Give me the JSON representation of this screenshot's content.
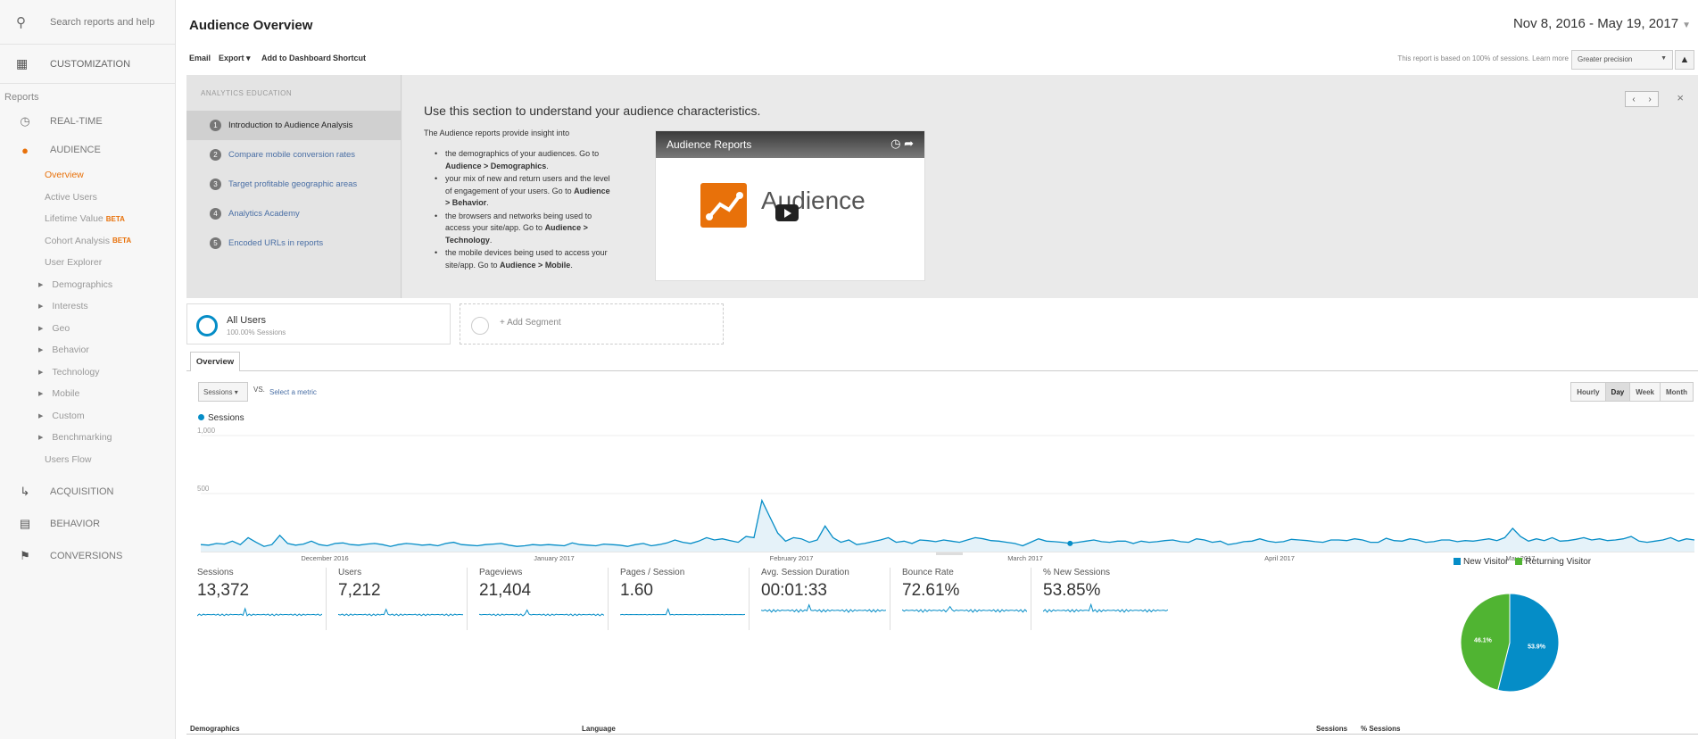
{
  "sidebar": {
    "search_label": "Search reports and help",
    "customization_label": "CUSTOMIZATION",
    "reports_label": "Reports",
    "realtime_label": "REAL-TIME",
    "audience_label": "AUDIENCE",
    "audience_items": [
      {
        "label": "Overview",
        "active": true
      },
      {
        "label": "Active Users"
      },
      {
        "label": "Lifetime Value",
        "badge": "BETA"
      },
      {
        "label": "Cohort Analysis",
        "badge": "BETA"
      },
      {
        "label": "User Explorer"
      },
      {
        "label": "Demographics",
        "expandable": true
      },
      {
        "label": "Interests",
        "expandable": true
      },
      {
        "label": "Geo",
        "expandable": true
      },
      {
        "label": "Behavior",
        "expandable": true
      },
      {
        "label": "Technology",
        "expandable": true
      },
      {
        "label": "Mobile",
        "expandable": true
      },
      {
        "label": "Custom",
        "expandable": true
      },
      {
        "label": "Benchmarking",
        "expandable": true
      },
      {
        "label": "Users Flow"
      }
    ],
    "acquisition_label": "ACQUISITION",
    "behavior_label": "BEHAVIOR",
    "conversions_label": "CONVERSIONS"
  },
  "header": {
    "title": "Audience Overview",
    "date_range": "Nov 8, 2016 - May 19, 2017"
  },
  "toolbar": {
    "email": "Email",
    "export": "Export ▾",
    "add_to_dashboard": "Add to Dashboard",
    "shortcut": "Shortcut",
    "note": "This report is based on 100% of sessions.",
    "learn_more": "Learn more",
    "precision": "Greater precision"
  },
  "education": {
    "heading": "ANALYTICS EDUCATION",
    "items": [
      {
        "num": "1",
        "label": "Introduction to Audience Analysis",
        "active": true
      },
      {
        "num": "2",
        "label": "Compare mobile conversion rates"
      },
      {
        "num": "3",
        "label": "Target profitable geographic areas"
      },
      {
        "num": "4",
        "label": "Analytics Academy"
      },
      {
        "num": "5",
        "label": "Encoded URLs in reports"
      }
    ],
    "title": "Use this section to understand your audience characteristics.",
    "intro": "The Audience reports provide insight into",
    "bullets": [
      {
        "text": "the demographics of your audiences. Go to ",
        "bold": "Audience > Demographics",
        "end": "."
      },
      {
        "text": "your mix of new and return users and the level of engagement of your users. Go to ",
        "bold": "Audience > Behavior",
        "end": "."
      },
      {
        "text": "the browsers and networks being used to access your site/app. Go to ",
        "bold": "Audience > Technology",
        "end": "."
      },
      {
        "text": "the mobile devices being used to access your site/app. Go to ",
        "bold": "Audience > Mobile",
        "end": "."
      }
    ],
    "video_title": "Audience Reports",
    "video_word": "Audience"
  },
  "segments": {
    "all_users": "All Users",
    "all_users_sub": "100.00% Sessions",
    "add_segment": "+ Add Segment"
  },
  "tabs": {
    "overview": "Overview"
  },
  "controls": {
    "metric": "Sessions",
    "vs": "VS.",
    "select_metric": "Select a metric",
    "granularity": [
      {
        "label": "Hourly"
      },
      {
        "label": "Day",
        "active": true
      },
      {
        "label": "Week"
      },
      {
        "label": "Month"
      }
    ]
  },
  "chart_data": {
    "type": "area",
    "series": [
      {
        "name": "Sessions",
        "color": "#058dc7"
      }
    ],
    "y_tick_labels": [
      "1,000",
      "500"
    ],
    "x_tick_labels": [
      "December 2016",
      "January 2017",
      "February 2017",
      "March 2017",
      "April 2017",
      "May 2017"
    ],
    "values": [
      60,
      55,
      70,
      65,
      90,
      60,
      120,
      80,
      45,
      60,
      140,
      70,
      55,
      65,
      90,
      60,
      50,
      70,
      75,
      60,
      55,
      65,
      70,
      60,
      45,
      60,
      70,
      65,
      55,
      60,
      50,
      70,
      80,
      60,
      55,
      50,
      60,
      65,
      70,
      55,
      45,
      50,
      60,
      55,
      60,
      55,
      50,
      75,
      60,
      55,
      50,
      65,
      60,
      55,
      45,
      60,
      70,
      50,
      60,
      75,
      100,
      80,
      70,
      90,
      120,
      100,
      110,
      95,
      80,
      130,
      120,
      440,
      300,
      160,
      90,
      120,
      110,
      80,
      100,
      220,
      120,
      80,
      100,
      60,
      70,
      85,
      100,
      120,
      80,
      90,
      70,
      100,
      95,
      85,
      100,
      90,
      80,
      100,
      120,
      110,
      95,
      90,
      80,
      70,
      50,
      80,
      110,
      90,
      85,
      80,
      70,
      80,
      90,
      100,
      85,
      80,
      90,
      90,
      70,
      90,
      80,
      85,
      95,
      100,
      85,
      80,
      110,
      100,
      80,
      90,
      60,
      70,
      85,
      90,
      110,
      90,
      80,
      85,
      105,
      100,
      95,
      85,
      80,
      100,
      100,
      95,
      110,
      100,
      80,
      80,
      115,
      95,
      90,
      110,
      100,
      80,
      85,
      100,
      100,
      85,
      95,
      90,
      100,
      110,
      95,
      120,
      200,
      130,
      90,
      110,
      95,
      120,
      90,
      95,
      105,
      120,
      100,
      110,
      95,
      100,
      110,
      130,
      90,
      80,
      90,
      100,
      120,
      90,
      110,
      100
    ],
    "ylim": [
      0,
      1000
    ],
    "marker_index": 110
  },
  "metrics": [
    {
      "label": "Sessions",
      "value": "13,372"
    },
    {
      "label": "Users",
      "value": "7,212"
    },
    {
      "label": "Pageviews",
      "value": "21,404"
    },
    {
      "label": "Pages / Session",
      "value": "1.60"
    },
    {
      "label": "Avg. Session Duration",
      "value": "00:01:33"
    },
    {
      "label": "Bounce Rate",
      "value": "72.61%"
    },
    {
      "label": "% New Sessions",
      "value": "53.85%"
    }
  ],
  "pie": {
    "type": "pie",
    "legend": [
      {
        "label": "New Visitor",
        "color": "#058dc7"
      },
      {
        "label": "Returning Visitor",
        "color": "#50b432"
      }
    ],
    "slices": [
      {
        "label": "New Visitor",
        "value": 53.9,
        "text": "53.9%",
        "color": "#058dc7"
      },
      {
        "label": "Returning Visitor",
        "value": 46.1,
        "text": "46.1%",
        "color": "#50b432"
      }
    ]
  },
  "bottom": {
    "demographics": "Demographics",
    "language": "Language",
    "sessions": "Sessions",
    "pct_sessions": "% Sessions"
  }
}
